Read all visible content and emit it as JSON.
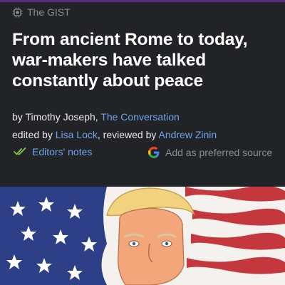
{
  "header": {
    "section_label": "The GIST"
  },
  "article": {
    "headline": "From ancient Rome to today, war-makers have talked constantly about peace",
    "byline": {
      "by_prefix": "by ",
      "author": "Timothy Joseph",
      "separator": ", ",
      "publisher": "The Conversation"
    },
    "credits": {
      "edited_prefix": "edited by ",
      "editor": "Lisa Lock",
      "reviewed_prefix": ", reviewed by ",
      "reviewer": "Andrew Zinin"
    }
  },
  "actions": {
    "editors_notes_label": "Editors' notes",
    "preferred_source_label": "Add as preferred source"
  },
  "icons": {
    "gist": "chip-icon",
    "editors_notes": "double-check-icon",
    "preferred_source": "google-icon"
  },
  "colors": {
    "background": "#212326",
    "link": "#6ea4ea",
    "muted": "#8b8d92",
    "notes_check": "#8bc34a",
    "accent_strip": "#5b2a86"
  }
}
